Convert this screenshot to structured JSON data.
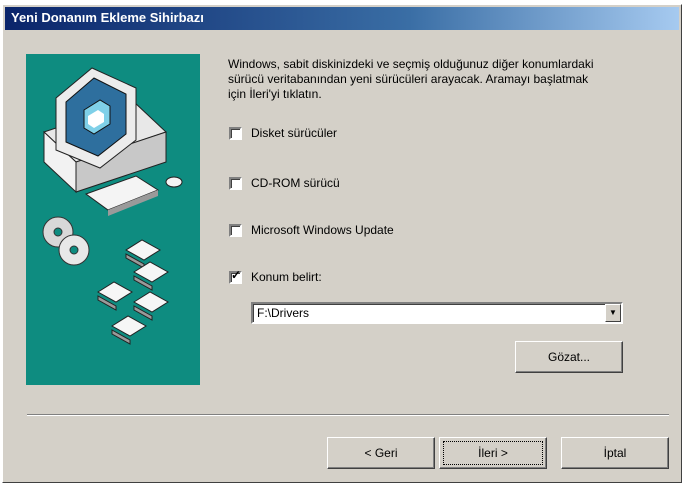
{
  "window": {
    "title": "Yeni Donanım Ekleme Sihirbazı"
  },
  "description": "Windows, sabit diskinizdeki ve seçmiş olduğunuz diğer konumlardaki sürücü veritabanından yeni sürücüleri arayacak. Aramayı başlatmak için İleri'yi tıklatın.",
  "options": [
    {
      "label": "Disket sürücüler",
      "checked": false
    },
    {
      "label": "CD-ROM sürücü",
      "checked": false
    },
    {
      "label": "Microsoft Windows Update",
      "checked": false
    },
    {
      "label": "Konum belirt:",
      "checked": true
    }
  ],
  "location": {
    "value": "F:\\Drivers"
  },
  "buttons": {
    "browse": "Gözat...",
    "back": "< Geri",
    "next": "İleri >",
    "cancel": "İptal"
  },
  "colors": {
    "title_bar": "#0a246a",
    "dialog_bg": "#d4d0c8",
    "illustration_bg": "#0e8c80"
  }
}
